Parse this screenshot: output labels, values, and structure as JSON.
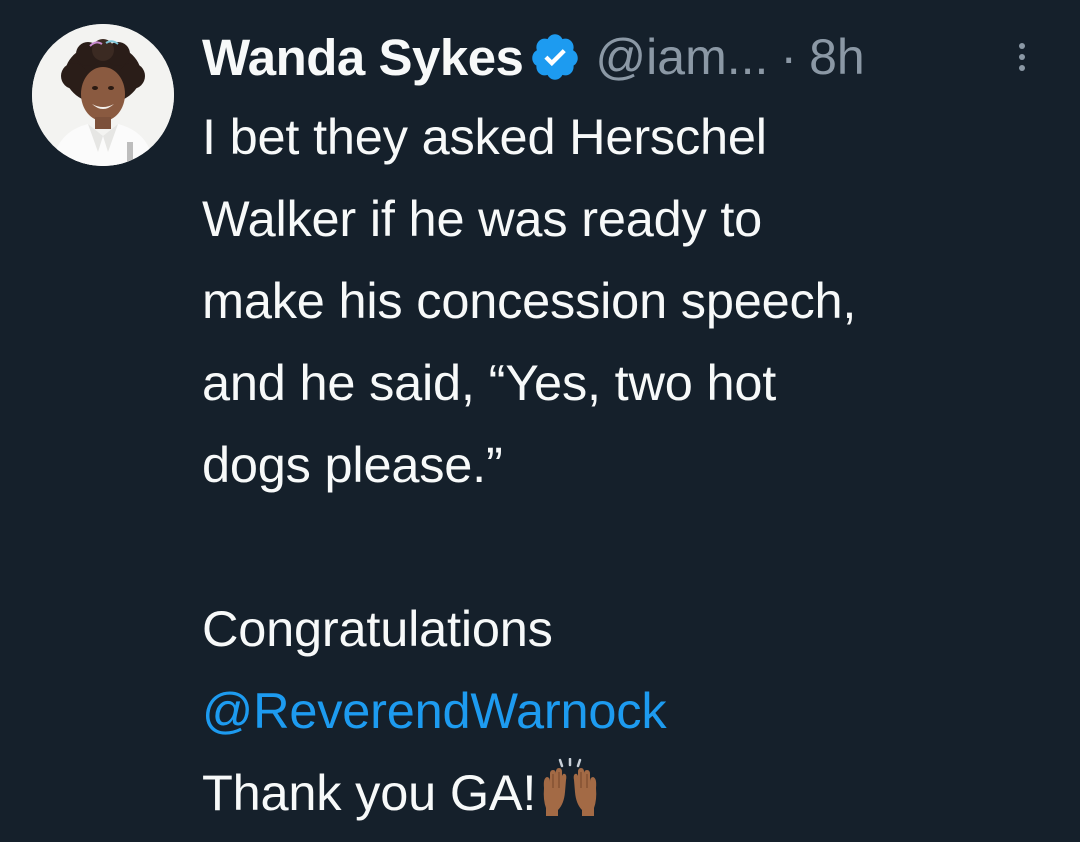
{
  "tweet": {
    "display_name": "Wanda Sykes",
    "handle": "@iam...",
    "separator": "·",
    "time": "8h",
    "verified_icon": "verified-badge-icon",
    "more_icon": "more-options-icon",
    "avatar": "avatar-photo",
    "lines": [
      "I bet they asked Herschel",
      "Walker if he was ready to",
      "make his concession speech,",
      "and he said, “Yes, two hot",
      "dogs please.”"
    ],
    "closing": "Congratulations",
    "mention": "@ReverendWarnock",
    "thanks": "Thank you GA!",
    "thanks_emoji": "raising-hands-emoji"
  },
  "colors": {
    "background": "#15202b",
    "text": "#f7f9f9",
    "secondary_text": "#8b98a5",
    "link": "#1d9bf0",
    "verified": "#1d9bf0"
  }
}
